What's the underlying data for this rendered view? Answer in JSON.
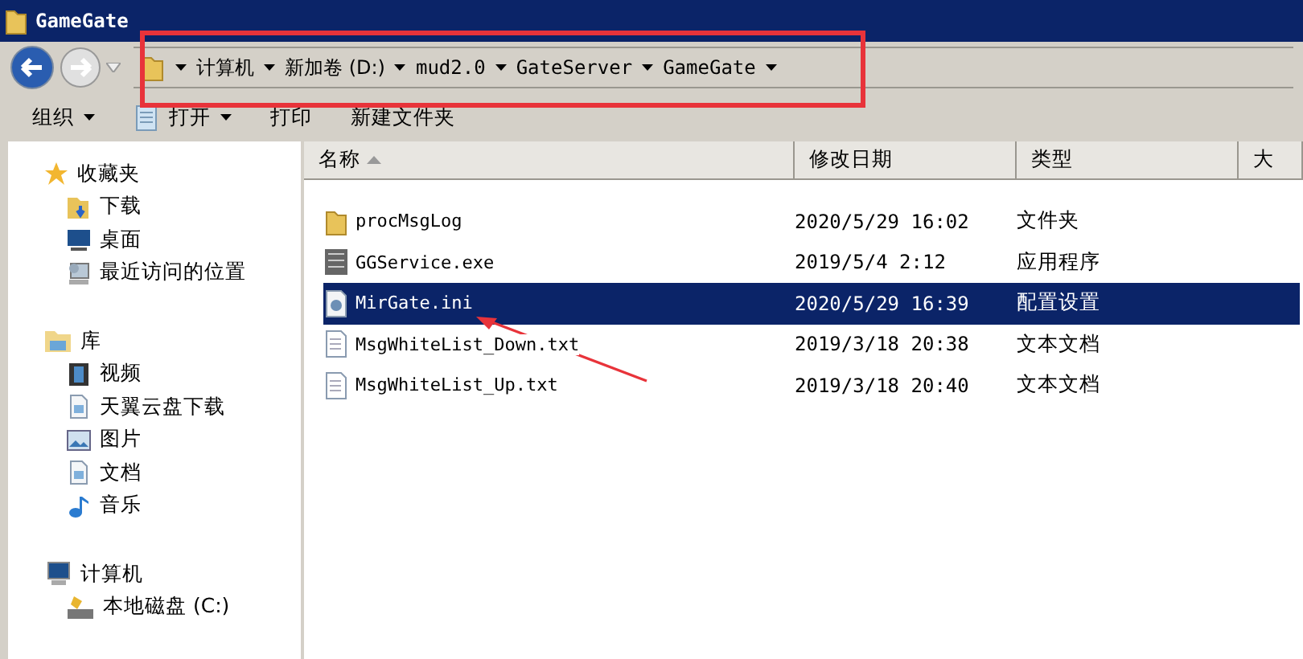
{
  "window": {
    "title": "GameGate"
  },
  "address": {
    "segments": [
      "计算机",
      "新加卷 (D:)",
      "mud2.0",
      "GateServer",
      "GameGate"
    ]
  },
  "toolbar": [
    {
      "label": "组织",
      "dropdown": true
    },
    {
      "label": "打开",
      "dropdown": true
    },
    {
      "label": "打印",
      "dropdown": false
    },
    {
      "label": "新建文件夹",
      "dropdown": false
    }
  ],
  "sidebar": {
    "groups": [
      {
        "label": "收藏夹",
        "children": [
          {
            "label": "下载"
          },
          {
            "label": "桌面"
          },
          {
            "label": "最近访问的位置"
          }
        ]
      },
      {
        "label": "库",
        "children": [
          {
            "label": "视频"
          },
          {
            "label": "天翼云盘下载"
          },
          {
            "label": "图片"
          },
          {
            "label": "文档"
          },
          {
            "label": "音乐"
          }
        ]
      },
      {
        "label": "计算机",
        "children": [
          {
            "label": "本地磁盘 (C:)"
          }
        ]
      }
    ]
  },
  "table": {
    "columns": [
      {
        "label": "名称",
        "sorted": true
      },
      {
        "label": "修改日期",
        "sorted": false
      },
      {
        "label": "类型",
        "sorted": false
      },
      {
        "label": "大",
        "sorted": false
      }
    ],
    "rows": [
      {
        "name": "procMsgLog",
        "date": "2020/5/29 16:02",
        "type": "文件夹",
        "kind": "folder",
        "selected": false
      },
      {
        "name": "GGService.exe",
        "date": "2019/5/4 2:12",
        "type": "应用程序",
        "kind": "exe",
        "selected": false
      },
      {
        "name": "MirGate.ini",
        "date": "2020/5/29 16:39",
        "type": "配置设置",
        "kind": "ini",
        "selected": true
      },
      {
        "name": "MsgWhiteList_Down.txt",
        "date": "2019/3/18 20:38",
        "type": "文本文档",
        "kind": "txt",
        "selected": false
      },
      {
        "name": "MsgWhiteList_Up.txt",
        "date": "2019/3/18 20:40",
        "type": "文本文档",
        "kind": "txt",
        "selected": false
      }
    ]
  }
}
